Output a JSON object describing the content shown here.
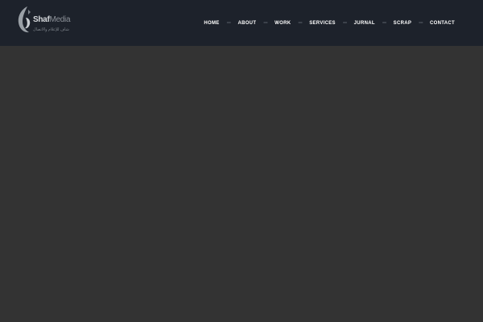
{
  "brand": {
    "name_part1": "Shaf",
    "name_part2": "Media",
    "tagline_arabic": "شاف للإعلام والاتصال"
  },
  "nav": {
    "items": [
      {
        "label": "HOME"
      },
      {
        "label": "ABOUT"
      },
      {
        "label": "WORK"
      },
      {
        "label": "SERVICES"
      },
      {
        "label": "JURNAL"
      },
      {
        "label": "SCRAP"
      },
      {
        "label": "CONTACT"
      }
    ],
    "separator": "=="
  },
  "colors": {
    "header_bg": "#1d222b",
    "page_bg": "#333333",
    "nav_text": "#ffffff",
    "separator": "#5d646d"
  }
}
